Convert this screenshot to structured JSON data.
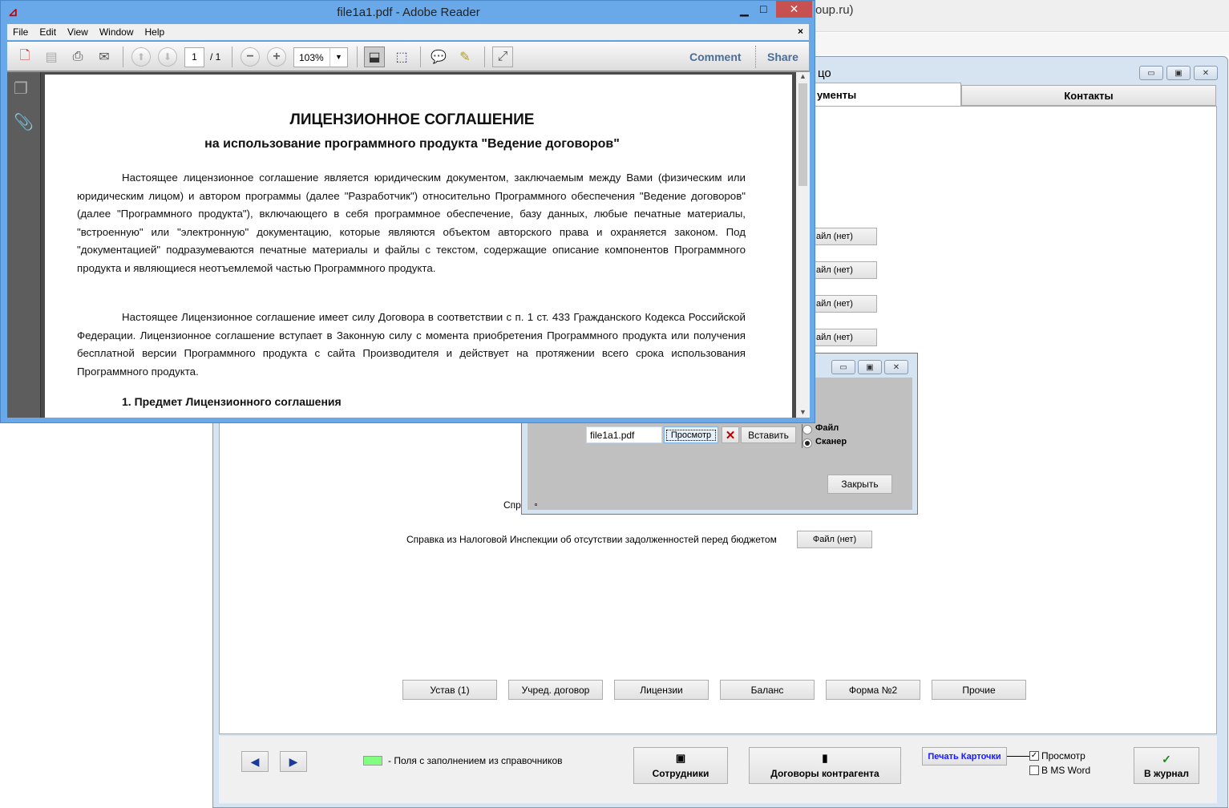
{
  "background": {
    "browser_title_fragment": "oup.ru)"
  },
  "app": {
    "title_fragment": "цо",
    "tabs": [
      {
        "label": "ументы",
        "active": true
      },
      {
        "label": "Контакты",
        "active": false
      }
    ],
    "file_buttons": [
      "айл (нет)",
      "айл (нет)",
      "айл (нет)",
      "айл (нет)"
    ],
    "hidden_label_fragment": "Спр",
    "tax_label": "Справка из Налоговой Инспекции об отсутствии задолженностей перед бюджетом",
    "tax_file_button": "Файл (нет)",
    "doc_buttons": [
      "Устав (1)",
      "Учред. договор",
      "Лицензии",
      "Баланс",
      "Форма №2",
      "Прочие"
    ],
    "bottom": {
      "legend_text": "- Поля с заполнением из справочников",
      "legend_color": "#80ff80",
      "employees_button": "Сотрудники",
      "contracts_button": "Договоры контрагента",
      "print_card_button": "Печать Карточки",
      "preview_checkbox": {
        "label": "Просмотр",
        "checked": true
      },
      "msword_checkbox": {
        "label": "В MS Word",
        "checked": false
      },
      "journal_button": "В журнал"
    }
  },
  "dialog": {
    "filename_value": "file1a1.pdf",
    "view_button": "Просмотр",
    "insert_button": "Вставить",
    "radio_file": {
      "label": "Файл",
      "selected": false
    },
    "radio_scanner": {
      "label": "Сканер",
      "selected": true
    },
    "close_button": "Закрыть"
  },
  "reader": {
    "title": "file1a1.pdf - Adobe Reader",
    "menu": [
      "File",
      "Edit",
      "View",
      "Window",
      "Help"
    ],
    "page_current": "1",
    "page_total": "/ 1",
    "zoom": "103%",
    "comment": "Comment",
    "share": "Share",
    "document": {
      "title": "ЛИЦЕНЗИОННОЕ СОГЛАШЕНИЕ",
      "subtitle": "на использование программного продукта \"Ведение договоров\"",
      "paragraph1": "Настоящее лицензионное соглашение является юридическим документом, заключаемым между Вами (физическим или юридическим лицом) и автором программы (далее  \"Разработчик\") относительно Программного обеспечения \"Ведение договоров\" (далее \"Программного продукта\"), включающего в себя программное обеспечение, базу данных, любые печатные материалы, \"встроенную\" или \"электронную\" документацию, которые являются объектом авторского права и охраняется законом. Под \"документацией\" подразумеваются печатные материалы и файлы с текстом, содержащие описание компонентов Программного продукта и являющиеся неотъемлемой частью Программного продукта.",
      "paragraph2": "Настоящее Лицензионное соглашение имеет силу Договора в соответствии с п. 1 ст. 433 Гражданского Кодекса Российской Федерации. Лицензионное соглашение вступает в Законную силу с момента приобретения Программного продукта или получения бесплатной версии Программного продукта с сайта Производителя и действует на протяжении всего срока использования Программного продукта.",
      "section1": "1. Предмет Лицензионного соглашения"
    }
  }
}
